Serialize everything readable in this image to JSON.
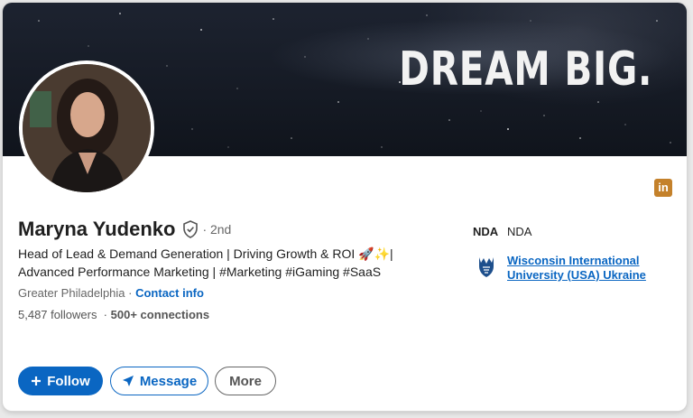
{
  "banner": {
    "text": "DREAM BIG."
  },
  "profile": {
    "name": "Maryna Yudenko",
    "degree": "· 2nd",
    "headline": "Head of Lead & Demand Generation | Driving Growth & ROI 🚀✨| Advanced Performance Marketing | #Marketing #iGaming #SaaS",
    "location": "Greater Philadelphia",
    "location_sep": " · ",
    "contact_info": "Contact info",
    "followers": "5,487 followers",
    "connections_sep": "  · ",
    "connections": "500+ connections"
  },
  "side": {
    "company_logo": "NDA",
    "company": "NDA",
    "university": "Wisconsin International University (USA) Ukraine"
  },
  "actions": {
    "follow": "Follow",
    "message": "Message",
    "more": "More"
  },
  "badge": {
    "label": "in"
  },
  "colors": {
    "accent": "#0a66c2",
    "linkedin_badge": "#c4812b"
  },
  "icons": [
    "verified-shield-icon",
    "plus-icon",
    "paper-plane-icon",
    "linkedin-icon",
    "university-logo-icon"
  ]
}
